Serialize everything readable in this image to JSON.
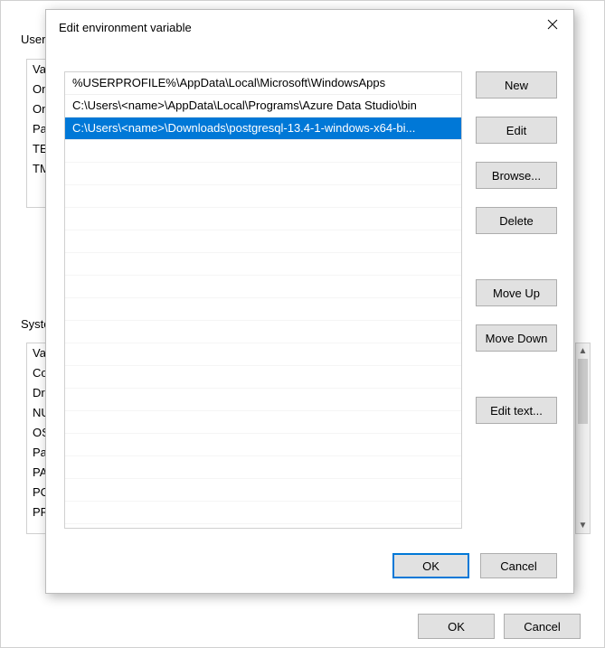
{
  "background": {
    "user_section_label": "User",
    "system_section_label": "Syste",
    "user_vars": [
      "Va",
      "On",
      "On",
      "Pat",
      "TE",
      "TM"
    ],
    "system_vars": [
      "Va",
      "Co",
      "Dri",
      "NU",
      "OS",
      "Pat",
      "PA",
      "PO",
      "PR"
    ],
    "ok_label": "OK",
    "cancel_label": "Cancel"
  },
  "dialog": {
    "title": "Edit environment variable",
    "paths": [
      "%USERPROFILE%\\AppData\\Local\\Microsoft\\WindowsApps",
      "C:\\Users\\<name>\\AppData\\Local\\Programs\\Azure Data Studio\\bin",
      "C:\\Users\\<name>\\Downloads\\postgresql-13.4-1-windows-x64-bi..."
    ],
    "selected_index": 2,
    "buttons": {
      "new": "New",
      "edit": "Edit",
      "browse": "Browse...",
      "delete": "Delete",
      "move_up": "Move Up",
      "move_down": "Move Down",
      "edit_text": "Edit text..."
    },
    "ok_label": "OK",
    "cancel_label": "Cancel"
  }
}
